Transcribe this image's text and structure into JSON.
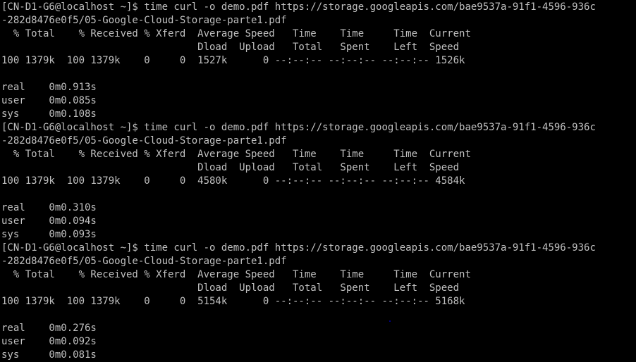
{
  "terminal": {
    "blocks": [
      {
        "prompt": "[CN-D1-G6@localhost ~]$ time curl -o demo.pdf https://storage.googleapis.com/bae9537a-91f1-4596-936c",
        "prompt_wrap": "-282d8476e0f5/05-Google-Cloud-Storage-parte1.pdf",
        "header1": "  % Total    % Received % Xferd  Average Speed   Time    Time     Time  Current",
        "header2": "                                 Dload  Upload   Total   Spent    Left  Speed",
        "progress": "100 1379k  100 1379k    0     0  1527k      0 --:--:-- --:--:-- --:--:-- 1526k",
        "real": "real    0m0.913s",
        "user": "user    0m0.085s",
        "sys": "sys     0m0.108s"
      },
      {
        "prompt": "[CN-D1-G6@localhost ~]$ time curl -o demo.pdf https://storage.googleapis.com/bae9537a-91f1-4596-936c",
        "prompt_wrap": "-282d8476e0f5/05-Google-Cloud-Storage-parte1.pdf",
        "header1": "  % Total    % Received % Xferd  Average Speed   Time    Time     Time  Current",
        "header2": "                                 Dload  Upload   Total   Spent    Left  Speed",
        "progress": "100 1379k  100 1379k    0     0  4580k      0 --:--:-- --:--:-- --:--:-- 4584k",
        "real": "real    0m0.310s",
        "user": "user    0m0.094s",
        "sys": "sys     0m0.093s"
      },
      {
        "prompt": "[CN-D1-G6@localhost ~]$ time curl -o demo.pdf https://storage.googleapis.com/bae9537a-91f1-4596-936c",
        "prompt_wrap": "-282d8476e0f5/05-Google-Cloud-Storage-parte1.pdf",
        "header1": "  % Total    % Received % Xferd  Average Speed   Time    Time     Time  Current",
        "header2": "                                 Dload  Upload   Total   Spent    Left  Speed",
        "progress": "100 1379k  100 1379k    0     0  5154k      0 --:--:-- --:--:-- --:--:-- 5168k",
        "real": "real    0m0.276s",
        "user": "user    0m0.092s",
        "sys": "sys     0m0.081s"
      }
    ],
    "colors": {
      "background": "#000000",
      "foreground": "#c0c0c0"
    }
  }
}
